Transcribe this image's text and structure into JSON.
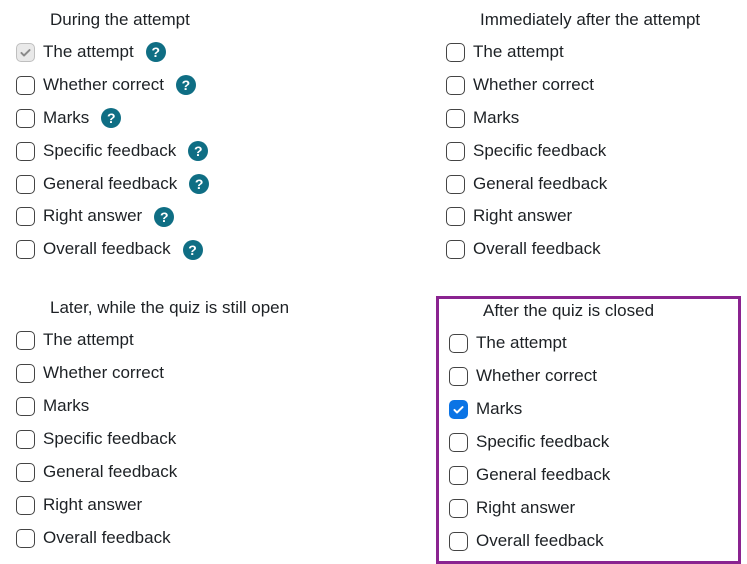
{
  "sections": [
    {
      "key": "during",
      "heading": "During the attempt",
      "show_help_icons": true,
      "highlighted": false,
      "options": [
        {
          "label": "The attempt",
          "state": "disabled-checked"
        },
        {
          "label": "Whether correct",
          "state": "unchecked"
        },
        {
          "label": "Marks",
          "state": "unchecked"
        },
        {
          "label": "Specific feedback",
          "state": "unchecked"
        },
        {
          "label": "General feedback",
          "state": "unchecked"
        },
        {
          "label": "Right answer",
          "state": "unchecked"
        },
        {
          "label": "Overall feedback",
          "state": "unchecked"
        }
      ]
    },
    {
      "key": "immediately",
      "heading": "Immediately after the attempt",
      "show_help_icons": false,
      "highlighted": false,
      "options": [
        {
          "label": "The attempt",
          "state": "unchecked"
        },
        {
          "label": "Whether correct",
          "state": "unchecked"
        },
        {
          "label": "Marks",
          "state": "unchecked"
        },
        {
          "label": "Specific feedback",
          "state": "unchecked"
        },
        {
          "label": "General feedback",
          "state": "unchecked"
        },
        {
          "label": "Right answer",
          "state": "unchecked"
        },
        {
          "label": "Overall feedback",
          "state": "unchecked"
        }
      ]
    },
    {
      "key": "later",
      "heading": "Later, while the quiz is still open",
      "show_help_icons": false,
      "highlighted": false,
      "options": [
        {
          "label": "The attempt",
          "state": "unchecked"
        },
        {
          "label": "Whether correct",
          "state": "unchecked"
        },
        {
          "label": "Marks",
          "state": "unchecked"
        },
        {
          "label": "Specific feedback",
          "state": "unchecked"
        },
        {
          "label": "General feedback",
          "state": "unchecked"
        },
        {
          "label": "Right answer",
          "state": "unchecked"
        },
        {
          "label": "Overall feedback",
          "state": "unchecked"
        }
      ]
    },
    {
      "key": "closed",
      "heading": "After the quiz is closed",
      "show_help_icons": false,
      "highlighted": true,
      "options": [
        {
          "label": "The attempt",
          "state": "unchecked"
        },
        {
          "label": "Whether correct",
          "state": "unchecked"
        },
        {
          "label": "Marks",
          "state": "checked"
        },
        {
          "label": "Specific feedback",
          "state": "unchecked"
        },
        {
          "label": "General feedback",
          "state": "unchecked"
        },
        {
          "label": "Right answer",
          "state": "unchecked"
        },
        {
          "label": "Overall feedback",
          "state": "unchecked"
        }
      ]
    }
  ]
}
